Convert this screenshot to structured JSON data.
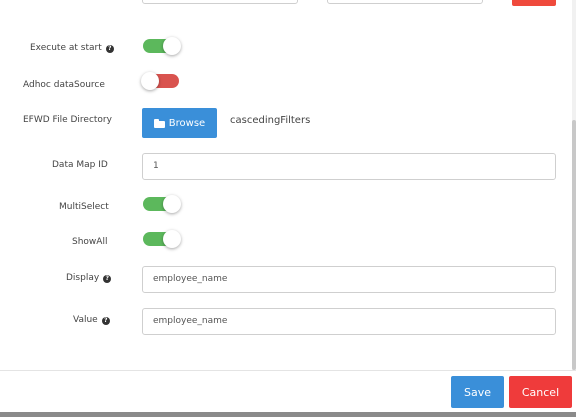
{
  "form": {
    "execute_at_start": {
      "label": "Execute at start",
      "state": "on",
      "has_help": true
    },
    "adhoc_datasource": {
      "label": "Adhoc dataSource",
      "state": "off"
    },
    "efwd_file_directory": {
      "label": "EFWD File Directory",
      "browse_label": "Browse",
      "value": "cascedingFilters"
    },
    "data_map_id": {
      "label": "Data Map ID",
      "value": "1"
    },
    "multiselect": {
      "label": "MultiSelect",
      "state": "on"
    },
    "show_all": {
      "label": "ShowAll",
      "state": "on"
    },
    "display": {
      "label": "Display",
      "value": "employee_name",
      "has_help": true
    },
    "value": {
      "label": "Value",
      "value": "employee_name",
      "has_help": true
    }
  },
  "footer": {
    "save_label": "Save",
    "cancel_label": "Cancel"
  },
  "colors": {
    "toggle_on": "#5cb85c",
    "toggle_off": "#d9534f",
    "primary": "#3a8fd9",
    "danger": "#ef3b3b"
  },
  "icons": {
    "help": "question-circle-icon",
    "browse": "folder-icon"
  }
}
